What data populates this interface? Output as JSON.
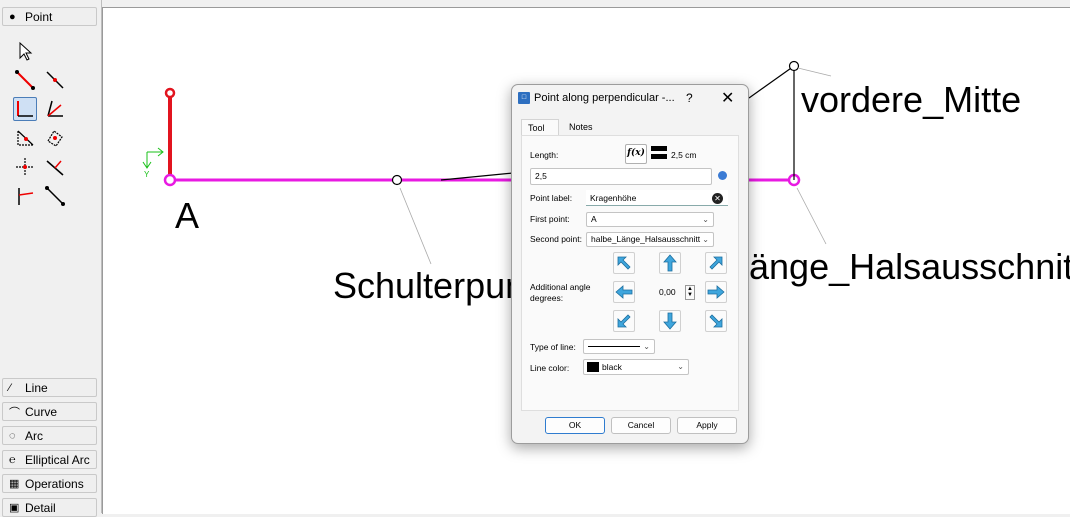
{
  "toolbox": {
    "point_group": "Point",
    "groups": [
      {
        "label": "Line",
        "icon": "line-icon",
        "glyph": "⁄"
      },
      {
        "label": "Curve",
        "icon": "curve-icon",
        "glyph": "⌒"
      },
      {
        "label": "Arc",
        "icon": "arc-icon",
        "glyph": "◌"
      },
      {
        "label": "Elliptical Arc",
        "icon": "elliptical-arc-icon",
        "glyph": "℮"
      },
      {
        "label": "Operations",
        "icon": "operations-icon",
        "glyph": "▦"
      },
      {
        "label": "Detail",
        "icon": "detail-icon",
        "glyph": "▣"
      }
    ],
    "tools": [
      "pointer-tool",
      "line-segment-tool",
      "along-line-tool",
      "perpendicular-tool",
      "bisector-tool",
      "triangle-tool",
      "intersect-tool",
      "shoulder-tool",
      "normal-tool",
      "midpoint-tool",
      "height-tool",
      "cut-tool"
    ]
  },
  "canvas": {
    "labels": {
      "a": "A",
      "schulter": "Schulterpun",
      "vordere": "vordere_Mitte",
      "hals": "änge_Halsausschnitt"
    },
    "axis_y": "Y",
    "colors": {
      "red": "#e2141f",
      "magenta": "#e81ae2",
      "axis": "#19c019"
    }
  },
  "dialog": {
    "title": "Point along perpendicular -...",
    "help": "?",
    "close": "✕",
    "tabs": [
      "Tool",
      "Notes"
    ],
    "length_label": "Length:",
    "fx": "f(x)",
    "length_value": "2,5 cm",
    "formula_value": "2,5",
    "point_label_label": "Point label:",
    "point_label_value": "Kragenhöhe",
    "first_point_label": "First point:",
    "first_point_value": "A",
    "second_point_label": "Second point:",
    "second_point_value": "halbe_Länge_Halsausschnitt",
    "angle_label": "Additional angle degrees:",
    "angle_value": "0,00",
    "type_of_line_label": "Type of line:",
    "line_color_label": "Line color:",
    "line_color_value": "black",
    "ok": "OK",
    "cancel": "Cancel",
    "apply": "Apply"
  }
}
